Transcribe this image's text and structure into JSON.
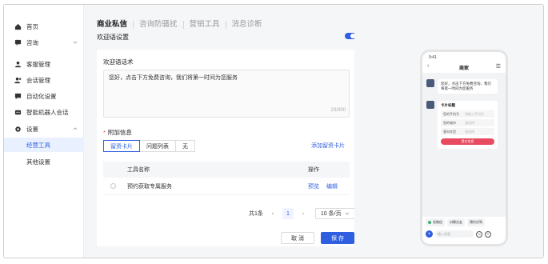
{
  "sidebar": {
    "items": [
      {
        "label": "首页",
        "icon": "home-icon"
      },
      {
        "label": "咨询",
        "icon": "chat-icon"
      },
      {
        "label": "客服管理",
        "icon": "user-icon"
      },
      {
        "label": "会话管理",
        "icon": "users-icon"
      },
      {
        "label": "自动化设置",
        "icon": "message-icon"
      },
      {
        "label": "智能机器人会话",
        "icon": "robot-icon"
      },
      {
        "label": "设置",
        "icon": "gear-icon"
      }
    ],
    "sub_items": [
      {
        "label": "经营工具",
        "active": true
      },
      {
        "label": "其他设置",
        "active": false
      }
    ]
  },
  "main": {
    "tabs": [
      {
        "label": "商业私信",
        "active": true
      },
      {
        "label": "咨询防骚扰",
        "active": false
      },
      {
        "label": "营销工具",
        "active": false
      },
      {
        "label": "消息诊断",
        "active": false
      }
    ],
    "section_title": "欢迎语设置",
    "toggle_on": true,
    "greeting_label": "欢迎语话术",
    "greeting_text": "您好，点击下方免费咨询，我们将第一时间为您服务",
    "greeting_counter": "23/300",
    "extra_label": "附加信息",
    "required_mark": "*",
    "segments": [
      {
        "label": "留资卡片",
        "active": true
      },
      {
        "label": "问题列表",
        "active": false
      },
      {
        "label": "无",
        "active": false
      }
    ],
    "add_link": "添加留资卡片",
    "table": {
      "headers": {
        "name": "工具名称",
        "ops": "操作"
      },
      "rows": [
        {
          "name": "预约获取专属服务",
          "op_preview": "预览",
          "op_edit": "编辑"
        }
      ]
    },
    "pager": {
      "total": "共1条",
      "prev": "‹",
      "page": "1",
      "next": "›",
      "size": "10 条/页"
    },
    "cancel_label": "取 消",
    "save_label": "保 存"
  },
  "phone": {
    "status": "9:41",
    "title": "商家",
    "back": "‹",
    "menu": "☰",
    "bubble_text": "您好，点击下方免费咨询，我们将第一时间为您服务",
    "card_title": "卡片标题",
    "fields": [
      {
        "label": "您的手机号",
        "placeholder": "请输入手机号"
      },
      {
        "label": "您的城市",
        "placeholder": "请选择"
      },
      {
        "label": "意向车型",
        "placeholder": "请选择"
      }
    ],
    "submit_label": "提交信息",
    "quick_replies": [
      "发微信",
      "对聊交友",
      "预约试驾"
    ],
    "input_placeholder": "输入消息",
    "colors": {
      "accent": "#2f5fe0",
      "submit": "#e84a5f"
    }
  }
}
